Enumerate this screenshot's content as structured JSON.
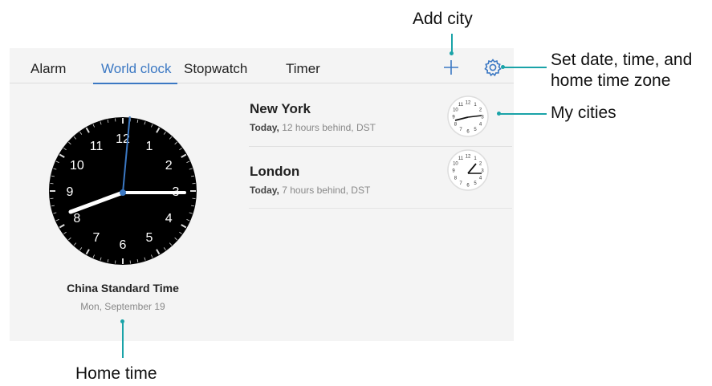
{
  "tabs": [
    {
      "label": "Alarm",
      "active": false
    },
    {
      "label": "World clock",
      "active": true
    },
    {
      "label": "Stopwatch",
      "active": false
    },
    {
      "label": "Timer",
      "active": false
    }
  ],
  "toolbar": {
    "add_icon": "plus-icon",
    "settings_icon": "gear-icon"
  },
  "home": {
    "zone": "China Standard Time",
    "date": "Mon, September 19"
  },
  "cities": [
    {
      "name": "New York",
      "day": "Today,",
      "offset": " 12 hours behind, DST"
    },
    {
      "name": "London",
      "day": "Today,",
      "offset": " 7 hours behind, DST"
    }
  ],
  "callouts": {
    "add_city": "Add city",
    "settings_line1": "Set date, time, and",
    "settings_line2": "home time zone",
    "my_cities": "My cities",
    "home_time": "Home time"
  },
  "colors": {
    "accent": "#3b78c3",
    "callout": "#1aa3a8",
    "clock_face": "#000000"
  },
  "home_clock_numerals": [
    "12",
    "1",
    "2",
    "3",
    "4",
    "5",
    "6",
    "7",
    "8",
    "9",
    "10",
    "11"
  ]
}
